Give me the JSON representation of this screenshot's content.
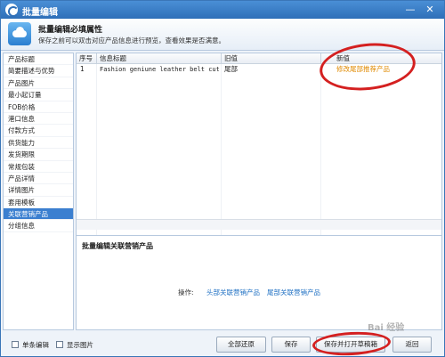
{
  "window": {
    "title": "批量编辑",
    "controls": [
      "—",
      "✕"
    ]
  },
  "info": {
    "heading": "批量编辑必填属性",
    "subtext": "保存之前可以双击对应产品信息进行预览，查看效果是否满意。"
  },
  "sidebar": {
    "items": [
      "产品标题",
      "简要描述与优势",
      "产品图片",
      "最小起订量",
      "FOB价格",
      "港口信息",
      "付款方式",
      "供货能力",
      "发货期限",
      "常规包装",
      "产品详情",
      "详情图片",
      "套用模板",
      "关联营销产品",
      "分组信息"
    ],
    "active_index": 13
  },
  "grid": {
    "headers": {
      "no": "序号",
      "title": "信息标题",
      "old": "旧值",
      "new": "新值"
    },
    "rows": [
      {
        "no": "1",
        "title": "Fashion geniune leather belt cut...",
        "old": "尾部",
        "new": "修改尾部推荐产品"
      }
    ]
  },
  "bottom_panel": {
    "title": "批量编辑关联营销产品",
    "op_label": "操作:",
    "links": [
      "头部关联营销产品",
      "尾部关联营销产品"
    ]
  },
  "footer": {
    "checkboxes": [
      "单条编辑",
      "显示图片"
    ],
    "buttons": {
      "restore": "全部还原",
      "save": "保存",
      "save_open": "保存并打开草稿箱",
      "back": "返回"
    }
  },
  "watermark": "Bai 经验",
  "colors": {
    "accent": "#3b7fd0",
    "annotation": "#d42020",
    "new_value": "#e08a00",
    "link": "#1d6fc3"
  }
}
